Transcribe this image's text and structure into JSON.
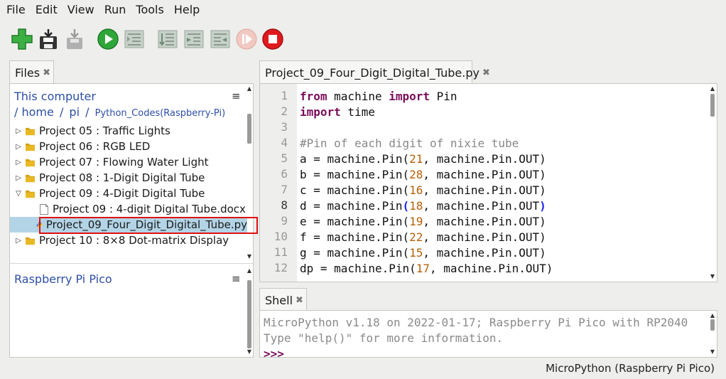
{
  "menu": [
    "File",
    "Edit",
    "View",
    "Run",
    "Tools",
    "Help"
  ],
  "toolbar": {
    "new_icon": "plus-icon",
    "save_icon": "save-icon",
    "load_icon": "download-icon",
    "run_icon": "play-icon",
    "debug_icon": "debug-icon",
    "step_over_icon": "step-over-icon",
    "step_into_icon": "step-into-icon",
    "step_out_icon": "step-out-icon",
    "resume_icon": "resume-icon",
    "stop_icon": "stop-icon"
  },
  "files_panel": {
    "tab_label": "Files",
    "tab_close": "✖",
    "this_computer": "This computer",
    "path": [
      "/",
      "home",
      "/",
      "pi",
      "/",
      "Python_Codes(Raspberry-Pi)"
    ],
    "menu_icon": "≡",
    "tree": [
      {
        "label": "Project 05 : Traffic Lights",
        "type": "folder",
        "expanded": false
      },
      {
        "label": "Project 06 : RGB LED",
        "type": "folder",
        "expanded": false
      },
      {
        "label": "Project 07 : Flowing Water Light",
        "type": "folder",
        "expanded": false
      },
      {
        "label": "Project 08 : 1-Digit Digital Tube",
        "type": "folder",
        "expanded": false
      },
      {
        "label": "Project 09 : 4-Digit Digital Tube",
        "type": "folder",
        "expanded": true
      },
      {
        "label": "Project 09 : 4-digit Digital Tube.docx",
        "type": "file"
      },
      {
        "label": "Project_09_Four_Digit_Digital_Tube.py",
        "type": "python",
        "selected": true
      },
      {
        "label": "Project 10 : 8×8 Dot-matrix Display",
        "type": "folder",
        "expanded": false
      }
    ],
    "pico_label": "Raspberry Pi Pico"
  },
  "editor": {
    "tab_label": "Project_09_Four_Digit_Digital_Tube.py",
    "tab_close": "✖",
    "line_numbers": [
      "1",
      "2",
      "3",
      "4",
      "5",
      "6",
      "7",
      "8",
      "9",
      "10",
      "11",
      "12"
    ],
    "code": {
      "l1": [
        "from",
        " machine ",
        "import",
        " Pin"
      ],
      "l2": [
        "import",
        " time"
      ],
      "l4": "#Pin of each digit of nixie tube",
      "l5": [
        "a = machine.Pin(",
        "21",
        ", machine.Pin.OUT)"
      ],
      "l6": [
        "b = machine.Pin(",
        "28",
        ", machine.Pin.OUT)"
      ],
      "l7": [
        "c = machine.Pin(",
        "16",
        ", machine.Pin.OUT)"
      ],
      "l8": [
        "d = machine.Pin",
        "(",
        "18",
        ", machine.Pin.OUT",
        ")"
      ],
      "l9": [
        "e = machine.Pin(",
        "19",
        ", machine.Pin.OUT)"
      ],
      "l10": [
        "f = machine.Pin(",
        "22",
        ", machine.Pin.OUT)"
      ],
      "l11": [
        "g = machine.Pin(",
        "15",
        ", machine.Pin.OUT)"
      ],
      "l12": [
        "dp = machine.Pin(",
        "17",
        ", machine.Pin.OUT)"
      ]
    }
  },
  "shell": {
    "tab_label": "Shell",
    "tab_close": "✖",
    "lines": [
      "MicroPython v1.18 on 2022-01-17; Raspberry Pi Pico with RP2040",
      "Type \"help()\" for more information."
    ],
    "prompt": ">>>"
  },
  "status": {
    "interpreter": "MicroPython (Raspberry Pi Pico)"
  },
  "colors": {
    "keyword": "#7a0d59",
    "number": "#b5600a",
    "comment": "#888888",
    "link": "#2d4fa3",
    "selection": "#b3d4e6",
    "highlight_box": "#e01010"
  }
}
